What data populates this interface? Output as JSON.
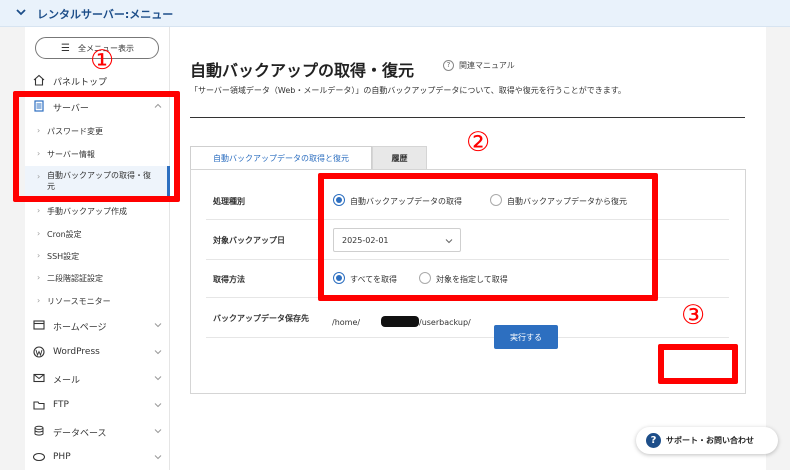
{
  "header": {
    "title": "レンタルサーバー:メニュー"
  },
  "sidebar": {
    "all_menu_label": "全メニュー表示",
    "items": [
      {
        "label": "パネルトップ"
      },
      {
        "label": "サーバー"
      },
      {
        "label": "パスワード変更"
      },
      {
        "label": "サーバー情報"
      },
      {
        "label": "自動バックアップの取得・復元"
      },
      {
        "label": "手動バックアップ作成"
      },
      {
        "label": "Cron設定"
      },
      {
        "label": "SSH設定"
      },
      {
        "label": "二段階認証設定"
      },
      {
        "label": "リソースモニター"
      },
      {
        "label": "ホームページ"
      },
      {
        "label": "WordPress"
      },
      {
        "label": "メール"
      },
      {
        "label": "FTP"
      },
      {
        "label": "データベース"
      },
      {
        "label": "PHP"
      }
    ]
  },
  "main": {
    "title": "自動バックアップの取得・復元",
    "manual_label": "関連マニュアル",
    "description": "「サーバー領域データ（Web・メールデータ）」の自動バックアップデータについて、取得や復元を行うことができます。",
    "tabs": [
      {
        "label": "自動バックアップデータの取得と復元"
      },
      {
        "label": "履歴"
      }
    ],
    "form": {
      "process_label": "処理種別",
      "process_options": [
        "自動バックアップデータの取得",
        "自動バックアップデータから復元"
      ],
      "process_selected": 0,
      "date_label": "対象バックアップ日",
      "date_value": "2025-02-01",
      "method_label": "取得方法",
      "method_options": [
        "すべてを取得",
        "対象を指定して取得"
      ],
      "method_selected": 0,
      "path_label": "バックアップデータ保存先",
      "path_prefix": "/home/",
      "path_suffix": "/userbackup/"
    },
    "execute_label": "実行する"
  },
  "annotations": [
    "①",
    "②",
    "③"
  ],
  "support": {
    "label": "サポート・お問い合わせ"
  },
  "colors": {
    "accent": "#2d6fc0",
    "annotation": "#ff0000",
    "header_bg": "#e9f2fb"
  }
}
